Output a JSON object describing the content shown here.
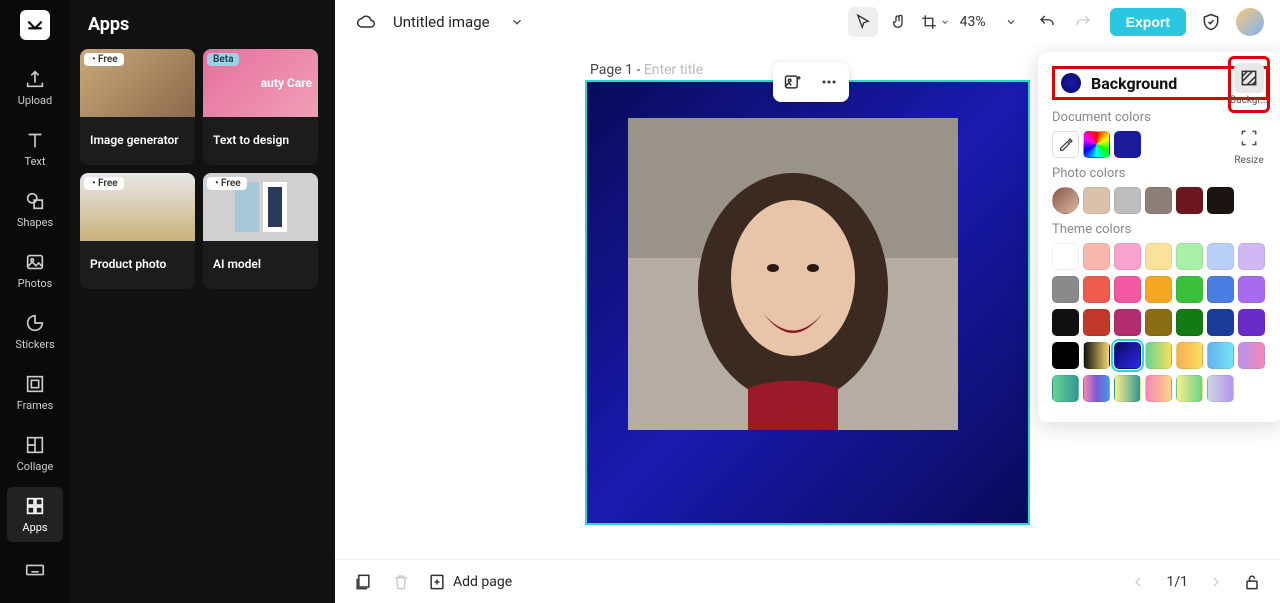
{
  "left_rail": {
    "items": [
      {
        "label": "Upload"
      },
      {
        "label": "Text"
      },
      {
        "label": "Shapes"
      },
      {
        "label": "Photos"
      },
      {
        "label": "Stickers"
      },
      {
        "label": "Frames"
      },
      {
        "label": "Collage"
      },
      {
        "label": "Apps"
      }
    ]
  },
  "side_panel": {
    "title": "Apps",
    "cards": [
      {
        "label": "Image generator",
        "badge": "Free"
      },
      {
        "label": "Text to design",
        "badge": "Beta",
        "thumb_text": "auty Care"
      },
      {
        "label": "Product photo",
        "badge": "Free"
      },
      {
        "label": "AI model",
        "badge": "Free"
      }
    ]
  },
  "topbar": {
    "doc_title": "Untitled image",
    "zoom": "43%",
    "export": "Export"
  },
  "canvas": {
    "page_prefix": "Page 1 - ",
    "title_placeholder": "Enter title"
  },
  "background_panel": {
    "title": "Background",
    "sections": {
      "document": "Document colors",
      "photo": "Photo colors",
      "theme": "Theme colors"
    },
    "document_colors": [
      "#1a1a9a"
    ],
    "photo_colors": [
      "#d9c1aa",
      "#bdbdbd",
      "#8c7e78",
      "#6d1820",
      "#1a1512"
    ],
    "theme_colors": [
      [
        "#ffffff",
        "#f9b7b0",
        "#f8a2cd",
        "#f9e29a",
        "#a9eea9",
        "#b8d0f6",
        "#d1b8f5"
      ],
      [
        "#8a8a8a",
        "#f05a4f",
        "#f358a3",
        "#f5a623",
        "#3bc03b",
        "#4a7de2",
        "#a86bf0"
      ],
      [
        "#101010",
        "#c0392b",
        "#b42d6f",
        "#8a6d14",
        "#147a14",
        "#1a3d9a",
        "#6a2cc7"
      ]
    ],
    "theme_gradients": [
      "linear-gradient(90deg,#111,#f5d76e)",
      "linear-gradient(135deg,#0a0a5a,#2a2af0)",
      "linear-gradient(90deg,#68d391,#f6e05e)",
      "linear-gradient(90deg,#f6ad55,#f6e05e)",
      "linear-gradient(90deg,#63b3ed,#76e4f7)",
      "linear-gradient(90deg,#b794f4,#f687b3)"
    ],
    "theme_gradients2": [
      "linear-gradient(90deg,#68d391,#319795)",
      "linear-gradient(90deg,#f687b3,#805ad5,#4299e1)",
      "linear-gradient(90deg,#faf089,#319795)",
      "linear-gradient(90deg,#f687b3,#fbd38d)",
      "linear-gradient(90deg,#faf089,#68d391)",
      "linear-gradient(90deg,#cbd5e0,#b794f4)"
    ]
  },
  "side_toolbar": {
    "background": "Backgr...",
    "resize": "Resize"
  },
  "bottombar": {
    "add_page": "Add page",
    "page_count": "1/1"
  }
}
